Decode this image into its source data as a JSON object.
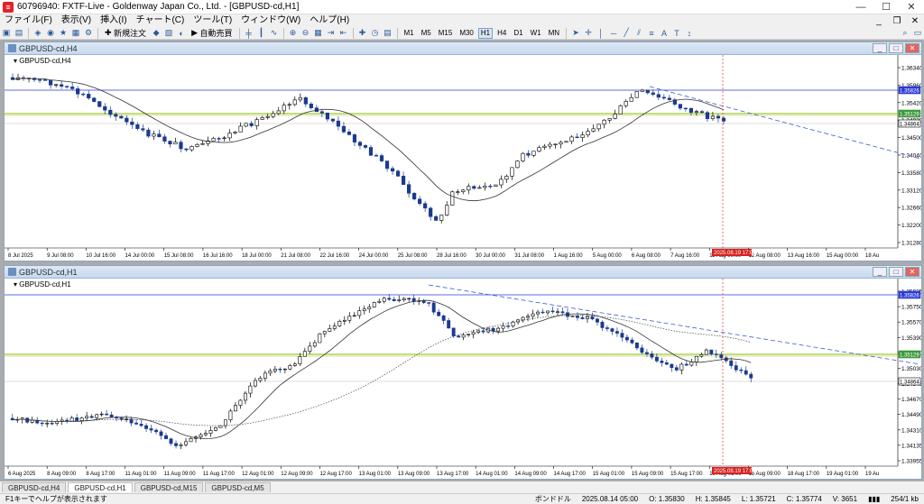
{
  "app": {
    "window_title": "60796940: FXTF-Live - Goldenway Japan Co., Ltd. - [GBPUSD-cd,H1]"
  },
  "menu": [
    "ファイル(F)",
    "表示(V)",
    "挿入(I)",
    "チャート(C)",
    "ツール(T)",
    "ウィンドウ(W)",
    "ヘルプ(H)"
  ],
  "toolbar": {
    "new_order_label": "新規注文",
    "auto_trade_label": "自動売買",
    "timeframes": [
      "M1",
      "M5",
      "M15",
      "M30",
      "H1",
      "H4",
      "D1",
      "W1",
      "MN"
    ],
    "active_timeframe": "H1"
  },
  "charts": [
    {
      "title": "GBPUSD-cd,H4",
      "label": "GBPUSD-cd,H4",
      "price_ticks": [
        "1.36340",
        "1.35960",
        "1.35420",
        "1.34920",
        "1.34500",
        "1.34040",
        "1.33580",
        "1.33120",
        "1.32660",
        "1.32200",
        "1.31280"
      ],
      "price_badges": [
        {
          "text": "1.35826",
          "color": "#2a3ad6"
        },
        {
          "text": "1.35129",
          "color": "#3c9a3c"
        },
        {
          "text": "1.34864",
          "color": "#000000"
        }
      ],
      "time_labels": [
        "8 Jul 2025",
        "9 Jul 08:00",
        "10 Jul 16:00",
        "14 Jul 00:00",
        "15 Jul 08:00",
        "16 Jul 16:00",
        "18 Jul 00:00",
        "21 Jul 08:00",
        "22 Jul 16:00",
        "24 Jul 00:00",
        "25 Jul 08:00",
        "28 Jul 16:00",
        "30 Jul 00:00",
        "31 Jul 08:00",
        "1 Aug 16:00",
        "5 Aug 00:00",
        "6 Aug 08:00",
        "7 Aug 16:00",
        "11 Aug 00:00",
        "12 Aug 08:00",
        "13 Aug 16:00",
        "15 Aug 00:00",
        "18 Au"
      ],
      "cursor_label": "2025.08.19 17:00"
    },
    {
      "title": "GBPUSD-cd,H1",
      "label": "GBPUSD-cd,H1",
      "price_ticks": [
        "1.35925",
        "1.35750",
        "1.35570",
        "1.35390",
        "1.35210",
        "1.35030",
        "1.34845",
        "1.34670",
        "1.34490",
        "1.34310",
        "1.34135",
        "1.33955"
      ],
      "price_badges": [
        {
          "text": "1.35826",
          "color": "#2a3ad6"
        },
        {
          "text": "1.35129",
          "color": "#3c9a3c"
        },
        {
          "text": "1.34864",
          "color": "#000000"
        }
      ],
      "time_labels": [
        "6 Aug 2025",
        "8 Aug 09:00",
        "8 Aug 17:00",
        "11 Aug 01:00",
        "11 Aug 09:00",
        "11 Aug 17:00",
        "12 Aug 01:00",
        "12 Aug 09:00",
        "12 Aug 17:00",
        "13 Aug 01:00",
        "13 Aug 09:00",
        "13 Aug 17:00",
        "14 Aug 01:00",
        "14 Aug 09:00",
        "14 Aug 17:00",
        "15 Aug 01:00",
        "15 Aug 09:00",
        "15 Aug 17:00",
        "18 Aug 01:00",
        "18 Aug 09:00",
        "18 Aug 17:00",
        "19 Aug 01:00",
        "19 Au"
      ],
      "cursor_label": "2025.08.19 17:00"
    }
  ],
  "tabs": [
    "GBPUSD-cd,H4",
    "GBPUSD-cd,H1",
    "GBPUSD-cd,M15",
    "GBPUSD-cd,M5"
  ],
  "active_tab": "GBPUSD-cd,H1",
  "status": {
    "help": "F1キーでヘルプが表示されます",
    "profile": "ボンドドル",
    "datetime": "2025.08.14 05:00",
    "open": "O: 1.35830",
    "high": "H: 1.35845",
    "low": "L: 1.35721",
    "close": "C: 1.35774",
    "volume": "V: 3651",
    "traffic": "254/1 kb"
  },
  "colors": {
    "bull": "#000000",
    "bear": "#1b3a8f",
    "ma": "#333333",
    "blue_line": "#2a3ad6",
    "green_line": "#9acd32",
    "trend": "#3b5bd6",
    "cursor": "#e03030"
  }
}
